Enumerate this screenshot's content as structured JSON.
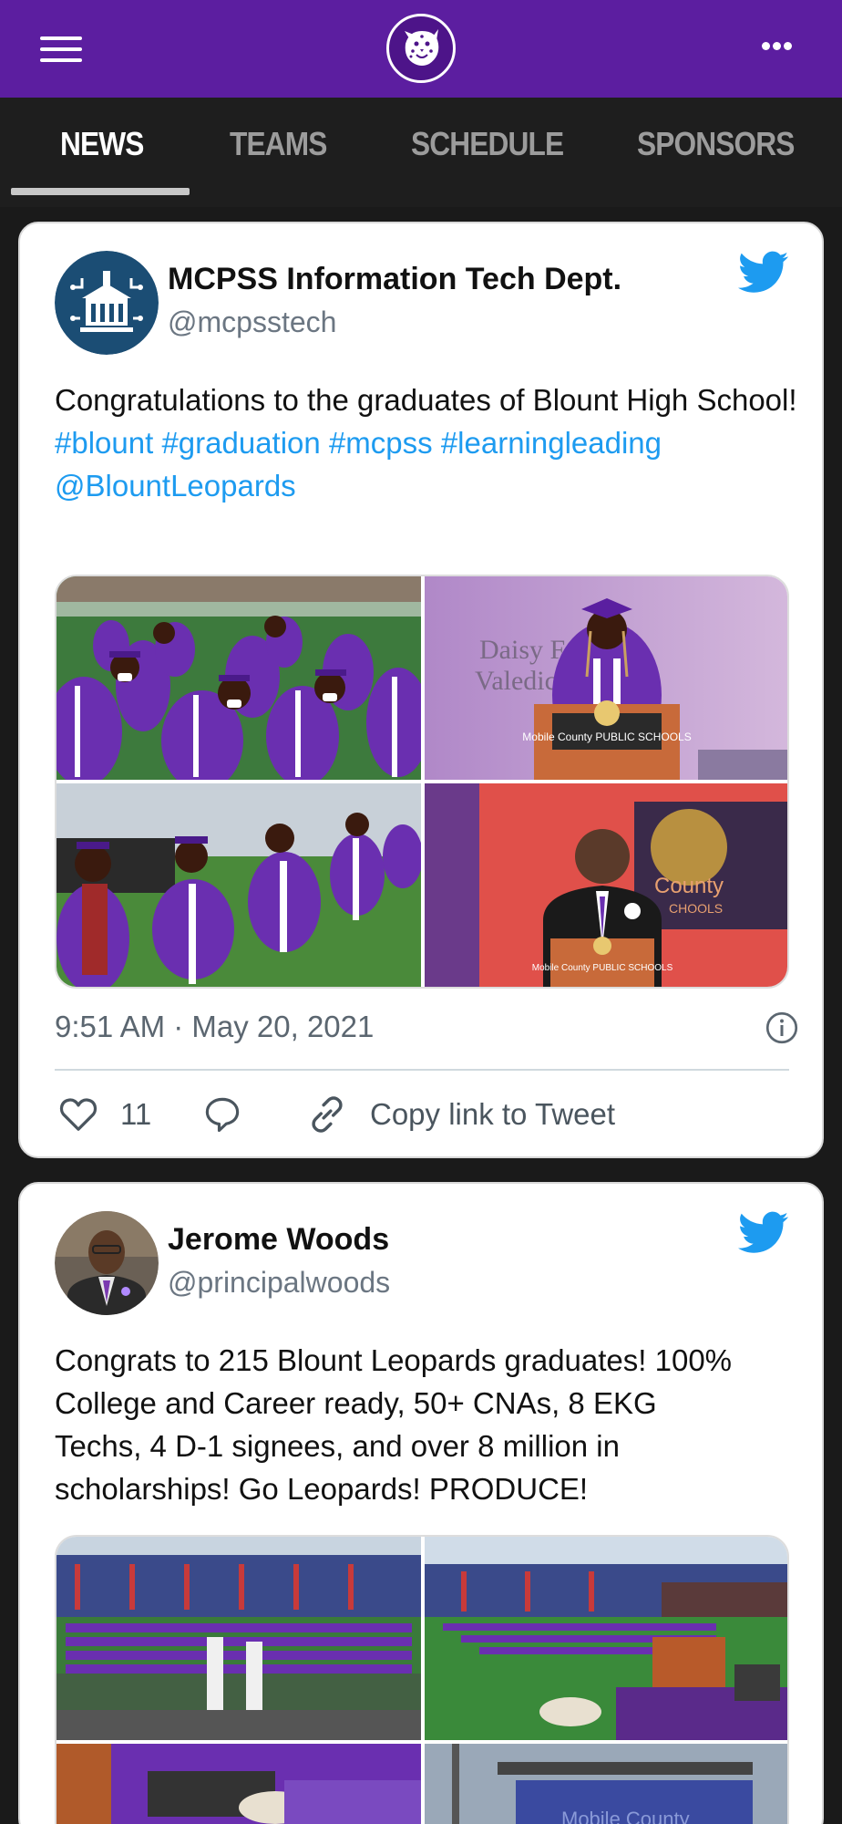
{
  "nav": {
    "tabs": [
      {
        "label": "NEWS",
        "active": true
      },
      {
        "label": "TEAMS",
        "active": false
      },
      {
        "label": "SCHEDULE",
        "active": false
      },
      {
        "label": "SPONSORS",
        "active": false
      }
    ]
  },
  "colors": {
    "header_bg": "#5c1ea0",
    "tabs_bg": "#1e1e1e",
    "link": "#1d9bf0",
    "twitter_blue": "#1d9bf0"
  },
  "icons": [
    "menu-icon",
    "leopard-logo-icon",
    "more-icon",
    "twitter-bird-icon",
    "heart-icon",
    "reply-icon",
    "link-icon",
    "info-icon"
  ],
  "tweets": [
    {
      "author_name": "MCPSS Information Tech Dept.",
      "handle": "@mcpsstech",
      "text": "Congratulations to the graduates of Blount High School!",
      "hashtags": [
        "#blount",
        "#graduation",
        "#mcpss",
        "#learningleading"
      ],
      "mention": "@BlountLeopards",
      "photo_captions": [
        "Daisy Fer",
        "Valedic",
        "Mobile County PUBLIC SCHOOLS",
        "County",
        "CHOOLS",
        "Mobile County PUBLIC SCHOOLS"
      ],
      "time": "9:51 AM · May 20, 2021",
      "likes": "11",
      "copy_link_label": "Copy link to Tweet"
    },
    {
      "author_name": "Jerome Woods",
      "handle": "@principalwoods",
      "text_lines": [
        "Congrats to 215 Blount Leopards graduates! 100%",
        "College and Career ready, 50+ CNAs, 8 EKG",
        "Techs, 4 D-1 signees, and over 8 million in",
        "scholarships! Go Leopards! PRODUCE!"
      ],
      "photo_captions": [
        "Mobile County"
      ]
    }
  ]
}
